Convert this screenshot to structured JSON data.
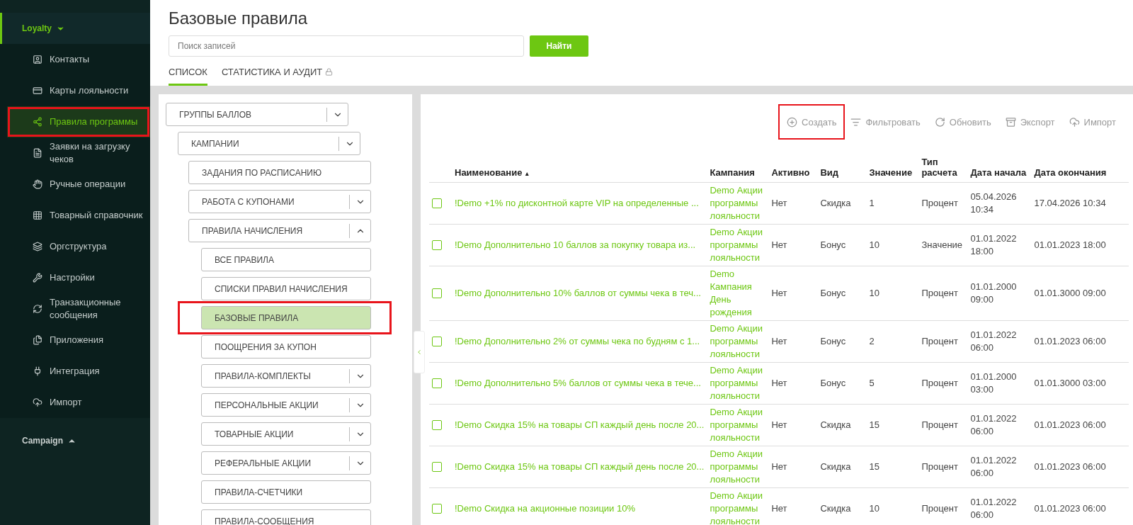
{
  "sidebar": {
    "sections": [
      {
        "label": "Loyalty",
        "expanded": true,
        "active": true,
        "items": [
          {
            "label": "Контакты",
            "selected": false,
            "highlighted": false
          },
          {
            "label": "Карты лояльности",
            "selected": false,
            "highlighted": false
          },
          {
            "label": "Правила программы",
            "selected": true,
            "highlighted": true
          },
          {
            "label": "Заявки на загрузку чеков",
            "selected": false,
            "highlighted": false
          },
          {
            "label": "Ручные операции",
            "selected": false,
            "highlighted": false
          },
          {
            "label": "Товарный справочник",
            "selected": false,
            "highlighted": false
          },
          {
            "label": "Оргструктура",
            "selected": false,
            "highlighted": false
          },
          {
            "label": "Настройки",
            "selected": false,
            "highlighted": false
          },
          {
            "label": "Транзакционные сообщения",
            "selected": false,
            "highlighted": false
          },
          {
            "label": "Приложения",
            "selected": false,
            "highlighted": false
          },
          {
            "label": "Интеграция",
            "selected": false,
            "highlighted": false
          },
          {
            "label": "Импорт",
            "selected": false,
            "highlighted": false
          }
        ]
      },
      {
        "label": "Campaign",
        "expanded": false,
        "active": false
      }
    ]
  },
  "header": {
    "title": "Базовые правила",
    "search": {
      "placeholder": "Поиск записей"
    },
    "search_button": "Найти",
    "tabs": [
      {
        "label": "СПИСОК",
        "selected": true,
        "locked": false
      },
      {
        "label": "СТАТИСТИКА И АУДИТ",
        "selected": false,
        "locked": true
      }
    ]
  },
  "tree": [
    {
      "label": "ГРУППЫ БАЛЛОВ",
      "expanded": false,
      "selected": false,
      "children": [
        {
          "label": "КАМПАНИИ",
          "expanded": false,
          "selected": false,
          "children": [
            {
              "label": "ЗАДАНИЯ ПО РАСПИСАНИЮ",
              "selected": false
            },
            {
              "label": "РАБОТА С КУПОНАМИ",
              "expanded": false,
              "selected": false
            },
            {
              "label": "ПРАВИЛА НАЧИСЛЕНИЯ",
              "expanded": true,
              "selected": false,
              "children": [
                {
                  "label": "ВСЕ ПРАВИЛА",
                  "selected": false
                },
                {
                  "label": "СПИСКИ ПРАВИЛ НАЧИСЛЕНИЯ",
                  "selected": false
                },
                {
                  "label": "БАЗОВЫЕ ПРАВИЛА",
                  "selected": true,
                  "highlighted": true
                },
                {
                  "label": "ПООЩРЕНИЯ ЗА КУПОН",
                  "selected": false
                },
                {
                  "label": "ПРАВИЛА-КОМПЛЕКТЫ",
                  "expanded": false,
                  "selected": false
                },
                {
                  "label": "ПЕРСОНАЛЬНЫЕ АКЦИИ",
                  "expanded": false,
                  "selected": false
                },
                {
                  "label": "ТОВАРНЫЕ АКЦИИ",
                  "expanded": false,
                  "selected": false
                },
                {
                  "label": "РЕФЕРАЛЬНЫЕ АКЦИИ",
                  "expanded": false,
                  "selected": false
                },
                {
                  "label": "ПРАВИЛА-СЧЕТЧИКИ",
                  "selected": false
                },
                {
                  "label": "ПРАВИЛА-СООБЩЕНИЯ",
                  "selected": false
                }
              ]
            }
          ]
        }
      ]
    }
  ],
  "toolbar": [
    {
      "kind": "create",
      "label": "Создать",
      "highlighted": true
    },
    {
      "kind": "filter",
      "label": "Фильтровать"
    },
    {
      "kind": "refresh",
      "label": "Обновить"
    },
    {
      "kind": "export",
      "label": "Экспорт"
    },
    {
      "kind": "import",
      "label": "Импорт"
    }
  ],
  "table": {
    "columns": [
      {
        "label": "Наименование",
        "sort_arrow": "▴"
      },
      {
        "label": "Кампания"
      },
      {
        "label": "Активно"
      },
      {
        "label": "Вид"
      },
      {
        "label": "Значение"
      },
      {
        "label": "Тип расчета"
      },
      {
        "label": "Дата начала"
      },
      {
        "label": "Дата окончания"
      }
    ],
    "rows": [
      {
        "checked": false,
        "cells": [
          "!Demo +1% по дисконтной карте VIP на определенные ...",
          "Demo Акции программы лояльности",
          "Нет",
          "Скидка",
          "1",
          "Процент",
          "05.04.2026 10:34",
          "17.04.2026 10:34"
        ]
      },
      {
        "checked": false,
        "cells": [
          "!Demo Дополнительно 10 баллов за покупку товара из...",
          "Demo Акции программы лояльности",
          "Нет",
          "Бонус",
          "10",
          "Значение",
          "01.01.2022 18:00",
          "01.01.2023 18:00"
        ]
      },
      {
        "checked": false,
        "cells": [
          "!Demo Дополнительно 10% баллов от суммы чека в теч...",
          "Demo Кампания День рождения",
          "Нет",
          "Бонус",
          "10",
          "Процент",
          "01.01.2000 09:00",
          "01.01.3000 09:00"
        ]
      },
      {
        "checked": false,
        "cells": [
          "!Demo Дополнительно 2% от суммы чека по будням с 1...",
          "Demo Акции программы лояльности",
          "Нет",
          "Бонус",
          "2",
          "Процент",
          "01.01.2022 06:00",
          "01.01.2023 06:00"
        ]
      },
      {
        "checked": false,
        "cells": [
          "!Demo Дополнительно 5% баллов от суммы чека в тече...",
          "Demo Акции программы лояльности",
          "Нет",
          "Бонус",
          "5",
          "Процент",
          "01.01.2000 03:00",
          "01.01.3000 03:00"
        ]
      },
      {
        "checked": false,
        "cells": [
          "!Demo Скидка 15% на товары СП каждый день после 20...",
          "Demo Акции программы лояльности",
          "Нет",
          "Скидка",
          "15",
          "Процент",
          "01.01.2022 06:00",
          "01.01.2023 06:00"
        ]
      },
      {
        "checked": false,
        "cells": [
          "!Demo Скидка 15% на товары СП каждый день после 20...",
          "Demo Акции программы лояльности",
          "Нет",
          "Скидка",
          "15",
          "Процент",
          "01.01.2022 06:00",
          "01.01.2023 06:00"
        ]
      },
      {
        "checked": false,
        "cells": [
          "!Demo Скидка на акционные позиции 10%",
          "Demo Акции программы лояльности",
          "Нет",
          "Скидка",
          "10",
          "Процент",
          "01.01.2022 06:00",
          "01.01.2023 06:00"
        ]
      }
    ]
  }
}
